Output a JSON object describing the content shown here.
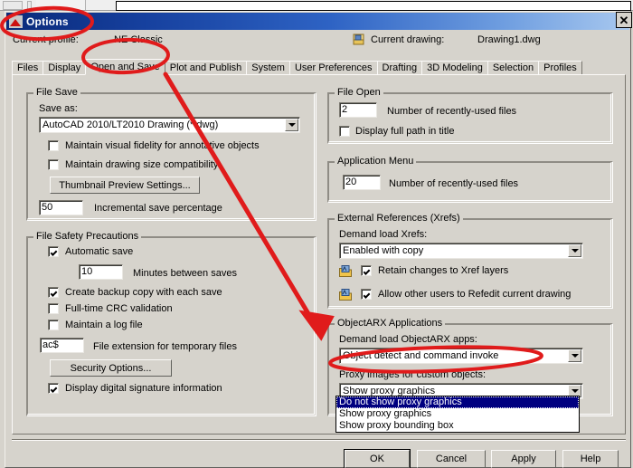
{
  "window": {
    "title": "Options",
    "close_label": "✕",
    "title_icon": "autocad-logo-icon"
  },
  "profile": {
    "profile_label": "Current profile:",
    "profile_value": "NE Classic",
    "drawing_label": "Current drawing:",
    "drawing_value": "Drawing1.dwg",
    "drawing_icon": "drawing-file-icon"
  },
  "tabs": [
    {
      "label": "Files",
      "active": false
    },
    {
      "label": "Display",
      "active": false
    },
    {
      "label": "Open and Save",
      "active": true
    },
    {
      "label": "Plot and Publish",
      "active": false
    },
    {
      "label": "System",
      "active": false
    },
    {
      "label": "User Preferences",
      "active": false
    },
    {
      "label": "Drafting",
      "active": false
    },
    {
      "label": "3D Modeling",
      "active": false
    },
    {
      "label": "Selection",
      "active": false
    },
    {
      "label": "Profiles",
      "active": false
    }
  ],
  "file_save": {
    "group_label": "File Save",
    "save_as_label": "Save as:",
    "save_as_value": "AutoCAD 2010/LT2010 Drawing (*.dwg)",
    "maintain_visual_fidelity": "Maintain visual fidelity for annotative objects",
    "maintain_visual_fidelity_checked": false,
    "maintain_drawing_size": "Maintain drawing size compatibility",
    "maintain_drawing_size_checked": false,
    "thumbnail_button": "Thumbnail Preview Settings...",
    "incremental_value": "50",
    "incremental_label": "Incremental save percentage"
  },
  "file_safety": {
    "group_label": "File Safety Precautions",
    "automatic_save": "Automatic save",
    "automatic_save_checked": true,
    "minutes_value": "10",
    "minutes_label": "Minutes between saves",
    "backup_copy": "Create backup copy with each save",
    "backup_copy_checked": true,
    "crc_validation": "Full-time CRC validation",
    "crc_validation_checked": false,
    "log_file": "Maintain a log file",
    "log_file_checked": false,
    "temp_ext_value": "ac$",
    "temp_ext_label": "File extension for temporary files",
    "security_button": "Security Options...",
    "digital_signature": "Display digital signature information",
    "digital_signature_checked": true
  },
  "file_open": {
    "group_label": "File Open",
    "recent_value": "2",
    "recent_label": "Number of recently-used files",
    "full_path": "Display full path in title",
    "full_path_checked": false
  },
  "app_menu": {
    "group_label": "Application Menu",
    "recent_value": "20",
    "recent_label": "Number of recently-used files"
  },
  "xrefs": {
    "group_label": "External References (Xrefs)",
    "demand_load_label": "Demand load Xrefs:",
    "demand_load_value": "Enabled with copy",
    "retain_changes": "Retain changes to Xref layers",
    "retain_changes_checked": true,
    "allow_refedit": "Allow other users to Refedit current drawing",
    "allow_refedit_checked": true,
    "icon_name": "xref-drawing-icon"
  },
  "objectarx": {
    "group_label": "ObjectARX Applications",
    "demand_load_label": "Demand load ObjectARX apps:",
    "demand_load_value": "Object detect and command invoke",
    "proxy_label": "Proxy images for custom objects:",
    "proxy_value": "Show proxy graphics",
    "proxy_options": [
      "Do not show proxy graphics",
      "Show proxy graphics",
      "Show proxy bounding box"
    ],
    "proxy_selected_index": 0
  },
  "buttons": {
    "ok": "OK",
    "cancel": "Cancel",
    "apply": "Apply",
    "help": "Help"
  },
  "annotations": {
    "color": "#e01b1b",
    "ellipse_title": "highlight-title",
    "ellipse_tab": "highlight-open-and-save-tab",
    "ellipse_proxy": "highlight-proxy-images-label",
    "arrow": "arrow-to-objectarx"
  }
}
